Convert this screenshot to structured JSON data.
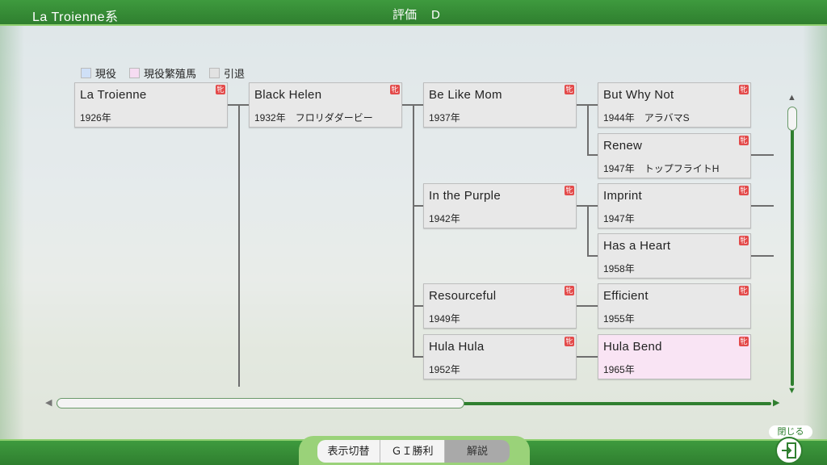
{
  "header": {
    "title": "La Troienne系",
    "rating_label": "評価",
    "rating_value": "D"
  },
  "legend": [
    {
      "label": "現役",
      "color": "#cfe0f7"
    },
    {
      "label": "現役繁殖馬",
      "color": "#f6dcf2"
    },
    {
      "label": "引退",
      "color": "#e2e2e2"
    }
  ],
  "tag_glyph": "牝",
  "nodes": [
    {
      "name": "La Troienne",
      "year": "1926年",
      "sub": ""
    },
    {
      "name": "Black Helen",
      "year": "1932年",
      "sub": "フロリダダービー"
    },
    {
      "name": "Be Like Mom",
      "year": "1937年",
      "sub": ""
    },
    {
      "name": "But Why Not",
      "year": "1944年",
      "sub": "アラバマS"
    },
    {
      "name": "Renew",
      "year": "1947年",
      "sub": "トップフライトH"
    },
    {
      "name": "In the Purple",
      "year": "1942年",
      "sub": ""
    },
    {
      "name": "Imprint",
      "year": "1947年",
      "sub": ""
    },
    {
      "name": "Has a Heart",
      "year": "1958年",
      "sub": ""
    },
    {
      "name": "Resourceful",
      "year": "1949年",
      "sub": ""
    },
    {
      "name": "Efficient",
      "year": "1955年",
      "sub": ""
    },
    {
      "name": "Hula Hula",
      "year": "1952年",
      "sub": ""
    },
    {
      "name": "Hula Bend",
      "year": "1965年",
      "sub": ""
    }
  ],
  "footer": {
    "tabs": [
      "表示切替",
      "ＧＩ勝利",
      "解説"
    ],
    "close_label": "閉じる"
  },
  "icons": {
    "close": "exit-door-icon",
    "scroll_up": "triangle-up-icon",
    "scroll_down": "triangle-down-icon",
    "scroll_left": "triangle-left-icon",
    "scroll_right": "triangle-right-icon"
  },
  "colors": {
    "accent": "#2f7f2f",
    "active_breeding": "#f9e4f4",
    "tag": "#e34a4a"
  }
}
